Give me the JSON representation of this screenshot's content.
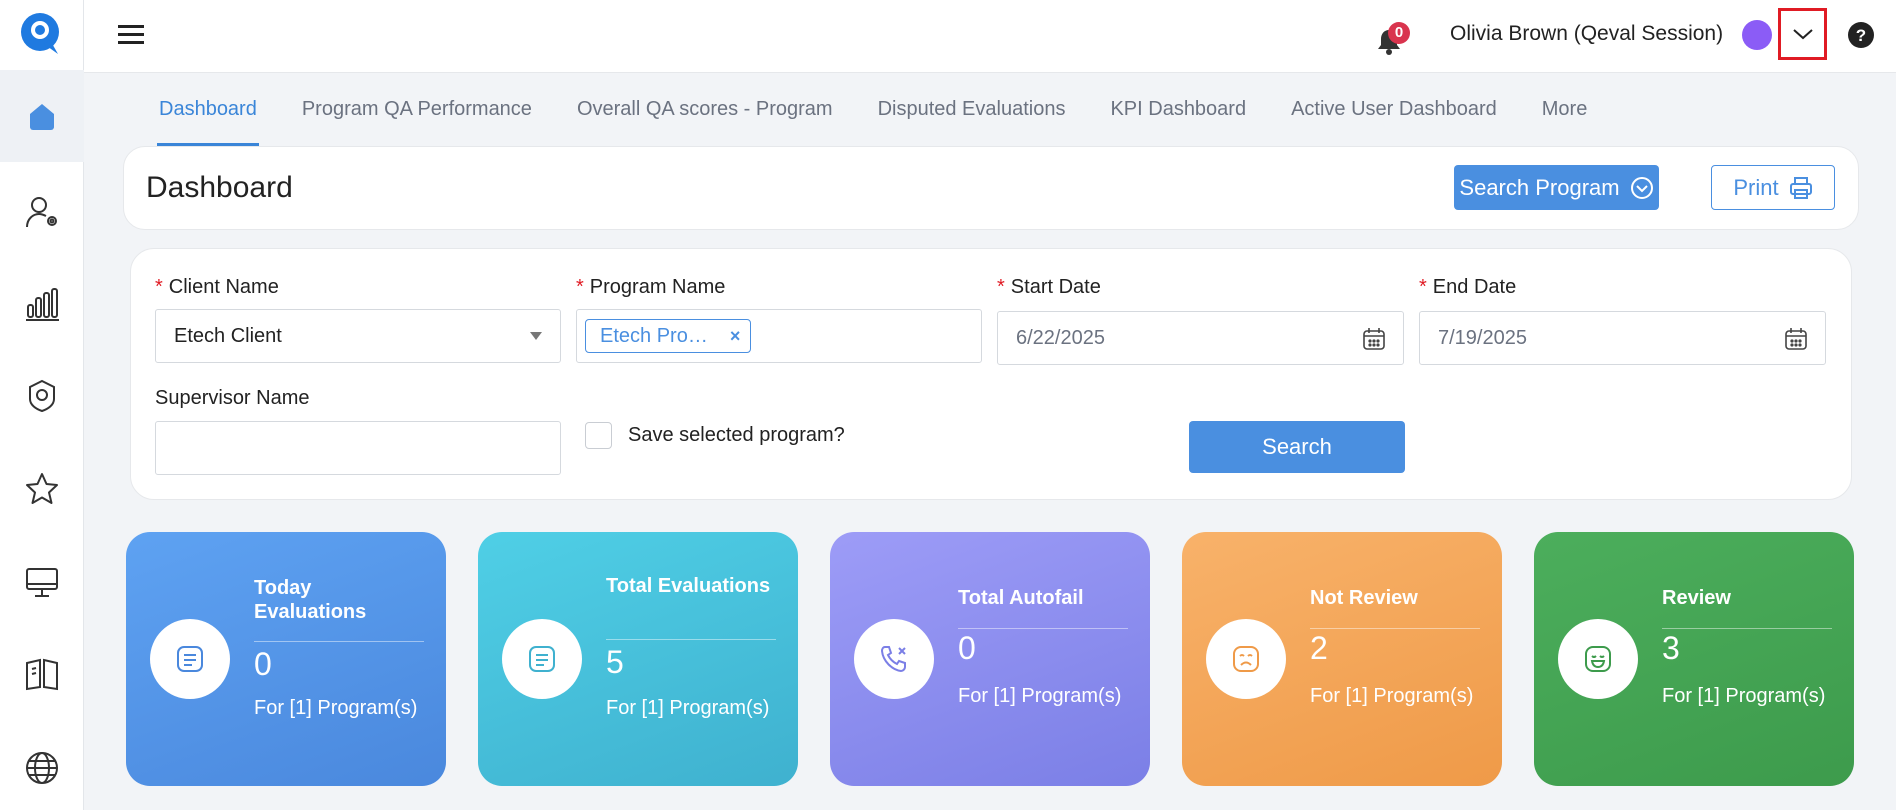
{
  "header": {
    "user_name": "Olivia Brown (Qeval Session)",
    "notification_count": "0"
  },
  "tabs": [
    {
      "label": "Dashboard",
      "active": true
    },
    {
      "label": "Program QA Performance"
    },
    {
      "label": "Overall QA scores - Program"
    },
    {
      "label": "Disputed Evaluations"
    },
    {
      "label": "KPI Dashboard"
    },
    {
      "label": "Active User Dashboard"
    },
    {
      "label": "More"
    }
  ],
  "page": {
    "title": "Dashboard",
    "search_program_label": "Search Program",
    "print_label": "Print"
  },
  "filters": {
    "client_name_label": "Client Name",
    "client_name_value": "Etech Client",
    "program_name_label": "Program Name",
    "program_chip": "Etech Pro…",
    "start_date_label": "Start Date",
    "start_date_value": "6/22/2025",
    "end_date_label": "End Date",
    "end_date_value": "7/19/2025",
    "supervisor_label": "Supervisor Name",
    "supervisor_value": "",
    "save_program_label": "Save selected program?",
    "search_label": "Search"
  },
  "stats": [
    {
      "title": "Today Evaluations",
      "value": "0",
      "foot": "For [1] Program(s)",
      "color_from": "#5ea2f2",
      "color_to": "#4a88dd",
      "icon": "document-icon"
    },
    {
      "title": "Total Evaluations",
      "value": "5",
      "foot": "For [1] Program(s)",
      "color_from": "#4fcfe6",
      "color_to": "#3fb1cf",
      "icon": "document-icon"
    },
    {
      "title": "Total Autofail",
      "value": "0",
      "foot": "For [1] Program(s)",
      "color_from": "#9d9cf7",
      "color_to": "#7b7fe6",
      "icon": "phone-missed-icon"
    },
    {
      "title": "Not Review",
      "value": "2",
      "foot": "For [1] Program(s)",
      "color_from": "#f8b26a",
      "color_to": "#ef9a48",
      "icon": "sad-face-icon"
    },
    {
      "title": "Review",
      "value": "3",
      "foot": "For [1] Program(s)",
      "color_from": "#4cae5c",
      "color_to": "#3d9b4c",
      "icon": "happy-face-icon"
    }
  ],
  "colors": {
    "accent": "#3a85d8",
    "primary_button": "#4a8fe0",
    "highlight_box": "#e01b24",
    "badge": "#d9344e"
  }
}
